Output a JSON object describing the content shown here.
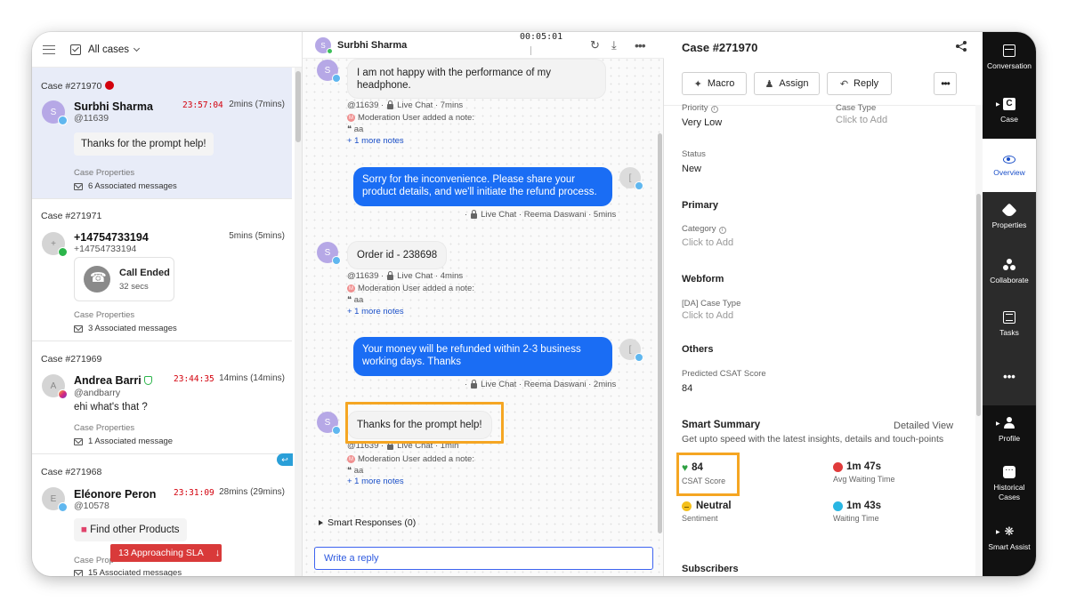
{
  "left_panel": {
    "header": {
      "filter_label": "All cases"
    },
    "cases": [
      {
        "id": "Case #271970",
        "name": "Surbhi Sharma",
        "handle": "@11639",
        "avatar_letter": "S",
        "timer": "23:57:04",
        "mins": "2mins (7mins)",
        "message": "Thanks for the prompt help!",
        "props_label": "Case Properties",
        "assoc": "6 Associated messages"
      },
      {
        "id": "Case #271971",
        "name": "+14754733194",
        "handle": "+14754733194",
        "avatar_letter": "+",
        "mins": "5mins (5mins)",
        "call_title": "Call Ended",
        "call_duration": "32 secs",
        "props_label": "Case Properties",
        "assoc": "3 Associated messages"
      },
      {
        "id": "Case #271969",
        "name": "Andrea Barri",
        "handle": "@andbarry",
        "avatar_letter": "A",
        "timer": "23:44:35",
        "mins": "14mins (14mins)",
        "message": "ehi what's that ?",
        "props_label": "Case Properties",
        "assoc": "1 Associated message"
      },
      {
        "id": "Case #271968",
        "name": "Eléonore Peron",
        "handle": "@10578",
        "avatar_letter": "E",
        "timer": "23:31:09",
        "mins": "28mins (29mins)",
        "message": "Find other Products",
        "props_label": "Case Prop",
        "assoc": "15 Associated messages"
      }
    ],
    "sla_pill": {
      "label": "13 Approaching SLA",
      "arrow": "↓"
    },
    "reply_tag": "↩"
  },
  "conversation": {
    "header": {
      "avatar_letter": "S",
      "name": "Surbhi Sharma",
      "timer": "00:05:01"
    },
    "messages": [
      {
        "type": "in",
        "avatar_letter": "S",
        "text": "I am not happy with the performance of my headphone.",
        "meta_handle": "@11639",
        "meta_channel": "Live Chat",
        "meta_time": "7mins",
        "note": "Moderation User added a note:",
        "quote": "aa",
        "more_notes": "+ 1 more notes"
      },
      {
        "type": "out",
        "avatar_letter": "[",
        "text": "Sorry for the inconvenience. Please share your product details, and we'll initiate the refund process.",
        "meta_channel": "Live Chat",
        "meta_agent": "Reema Daswani",
        "meta_time": "5mins"
      },
      {
        "type": "in",
        "avatar_letter": "S",
        "text": "Order id - 238698",
        "meta_handle": "@11639",
        "meta_channel": "Live Chat",
        "meta_time": "4mins",
        "note": "Moderation User added a note:",
        "quote": "aa",
        "more_notes": "+ 1 more notes"
      },
      {
        "type": "out",
        "avatar_letter": "[",
        "text": "Your money will be refunded within 2-3 business working days. Thanks",
        "meta_channel": "Live Chat",
        "meta_agent": "Reema Daswani",
        "meta_time": "2mins"
      },
      {
        "type": "in",
        "avatar_letter": "S",
        "text": "Thanks for the prompt help!",
        "meta_handle": "@11639",
        "meta_channel": "Live Chat",
        "meta_time": "1min",
        "note": "Moderation User added a note:",
        "quote": "aa",
        "more_notes": "+ 1 more notes"
      }
    ],
    "smart_responses": "Smart Responses (0)",
    "reply_placeholder": "Write a reply"
  },
  "case_panel": {
    "title": "Case #271970",
    "buttons": {
      "macro": "Macro",
      "assign": "Assign",
      "reply": "Reply"
    },
    "fields": {
      "priority_label": "Priority",
      "priority_value": "Very Low",
      "case_type_label": "Case Type",
      "case_type_value": "Click to Add",
      "status_label": "Status",
      "status_value": "New",
      "primary_section": "Primary",
      "category_label": "Category",
      "category_value": "Click to Add",
      "webform_section": "Webform",
      "da_case_type_label": "[DA] Case Type",
      "da_case_type_value": "Click to Add",
      "others_section": "Others",
      "csat_label": "Predicted CSAT Score",
      "csat_value": "84"
    },
    "smart_summary": {
      "title": "Smart Summary",
      "link": "Detailed View",
      "subtitle": "Get upto speed with the latest insights, details and touch-points",
      "metrics": [
        {
          "value": "84",
          "label": "CSAT Score"
        },
        {
          "value": "1m 47s",
          "label": "Avg Waiting Time"
        },
        {
          "value": "Neutral",
          "label": "Sentiment"
        },
        {
          "value": "1m 43s",
          "label": "Waiting Time"
        }
      ]
    },
    "subscribers": "Subscribers"
  },
  "nav_rail": {
    "items": [
      {
        "label": "Conversation"
      },
      {
        "label": "Case"
      },
      {
        "label": "Overview"
      },
      {
        "label": "Properties"
      },
      {
        "label": "Collaborate"
      },
      {
        "label": "Tasks"
      },
      {
        "label": "•••"
      },
      {
        "label": "Profile"
      },
      {
        "label": "Historical Cases"
      },
      {
        "label": "Smart Assist"
      }
    ]
  },
  "colors": {
    "accent_blue": "#1a6df4",
    "sla_red": "#d93a3a",
    "highlight_orange": "#f5a623",
    "rail_bg": "#111111"
  }
}
